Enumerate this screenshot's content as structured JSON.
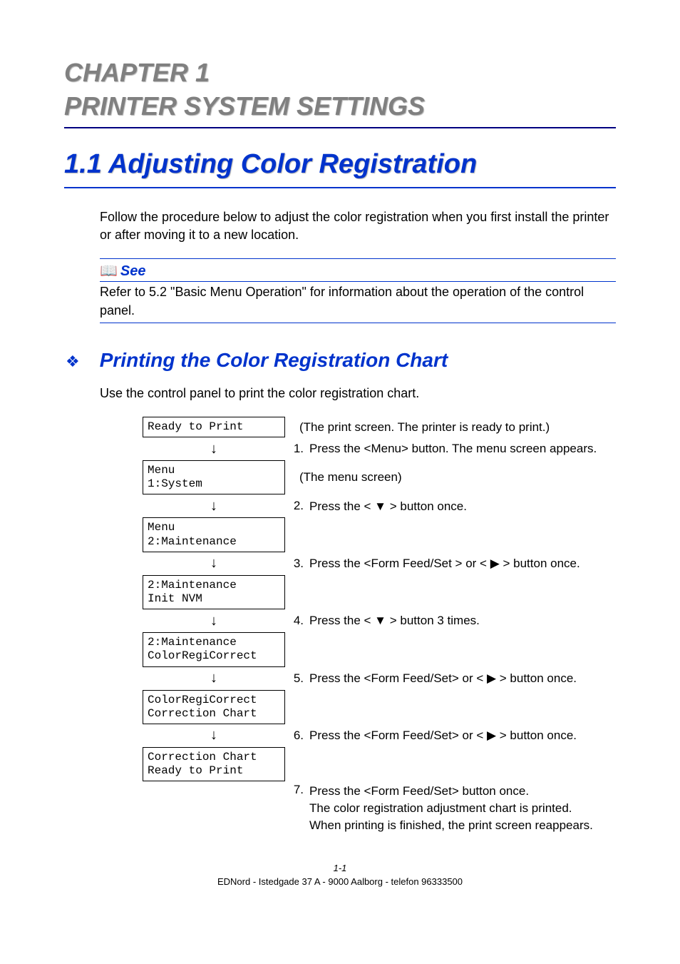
{
  "chapter": {
    "line1": "CHAPTER 1",
    "line2": "PRINTER SYSTEM SETTINGS"
  },
  "section": {
    "number_title": "1.1   Adjusting Color Registration",
    "intro": "Follow the procedure below to adjust the color registration when you first install the printer or after moving it to a new location."
  },
  "see": {
    "label": "See",
    "body": "Refer to 5.2  \"Basic Menu Operation\" for information about the operation of the control panel."
  },
  "subsection": {
    "title": "Printing the Color Registration Chart",
    "intro": "Use the control panel to print the color registration chart."
  },
  "steps": {
    "lcd0": "Ready to Print",
    "note0": "(The print screen. The printer is ready to print.)",
    "s1": "Press the <Menu> button. The menu screen appears.",
    "lcd1": "Menu\n1:System",
    "note1": "(The menu screen)",
    "s2": "Press the < ▼ > button once.",
    "lcd2": "Menu\n2:Maintenance",
    "s3": "Press the <Form Feed/Set > or < ▶ > button once.",
    "lcd3": "2:Maintenance\nInit NVM",
    "s4": "Press the < ▼ > button 3 times.",
    "lcd4": "2:Maintenance\nColorRegiCorrect",
    "s5": "Press the <Form Feed/Set> or < ▶ > button once.",
    "lcd5": "ColorRegiCorrect\nCorrection Chart",
    "s6": "Press the <Form Feed/Set> or < ▶ > button once.",
    "lcd6": "Correction Chart\nReady to Print",
    "s7a": "Press the <Form Feed/Set> button once.",
    "s7b": "The color registration adjustment chart is printed.",
    "s7c": "When printing is finished, the print screen reappears."
  },
  "arrow": "↓",
  "nums": {
    "n1": "1.",
    "n2": "2.",
    "n3": "3.",
    "n4": "4.",
    "n5": "5.",
    "n6": "6.",
    "n7": "7."
  },
  "page_number": "1-1",
  "footer": "EDNord - Istedgade 37 A - 9000 Aalborg - telefon 96333500"
}
